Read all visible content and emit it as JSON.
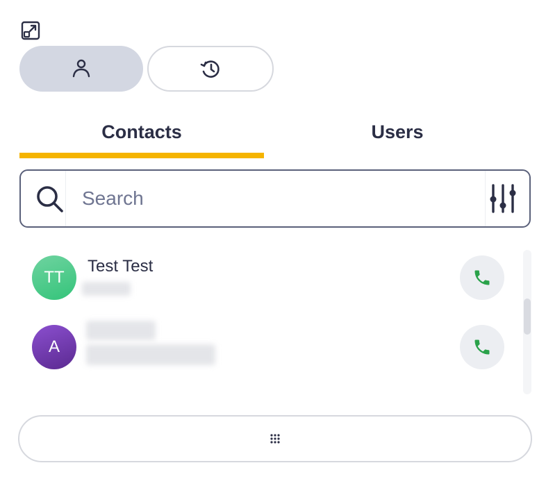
{
  "header": {
    "popout_icon": "popout-icon",
    "mode_toggles": [
      {
        "id": "contacts",
        "icon": "person-icon",
        "active": true
      },
      {
        "id": "history",
        "icon": "history-icon",
        "active": false
      }
    ]
  },
  "tabs": [
    {
      "label": "Contacts",
      "active": true
    },
    {
      "label": "Users",
      "active": false
    }
  ],
  "search": {
    "placeholder": "Search",
    "value": "",
    "filter_icon": "filter-sliders-icon"
  },
  "contacts": [
    {
      "initials": "TT",
      "name": "Test Test",
      "avatar_color": "#4fcd8c",
      "call_icon": "phone-icon"
    },
    {
      "initials": "A",
      "name": "",
      "avatar_color": "#6b35a8",
      "call_icon": "phone-icon"
    }
  ],
  "footer": {
    "dialpad_icon": "dialpad-icon"
  },
  "colors": {
    "accent_underline": "#f5b400",
    "call_green": "#2aa24a",
    "active_toggle_bg": "#d3d7e2",
    "text_dark": "#2b2e45"
  }
}
